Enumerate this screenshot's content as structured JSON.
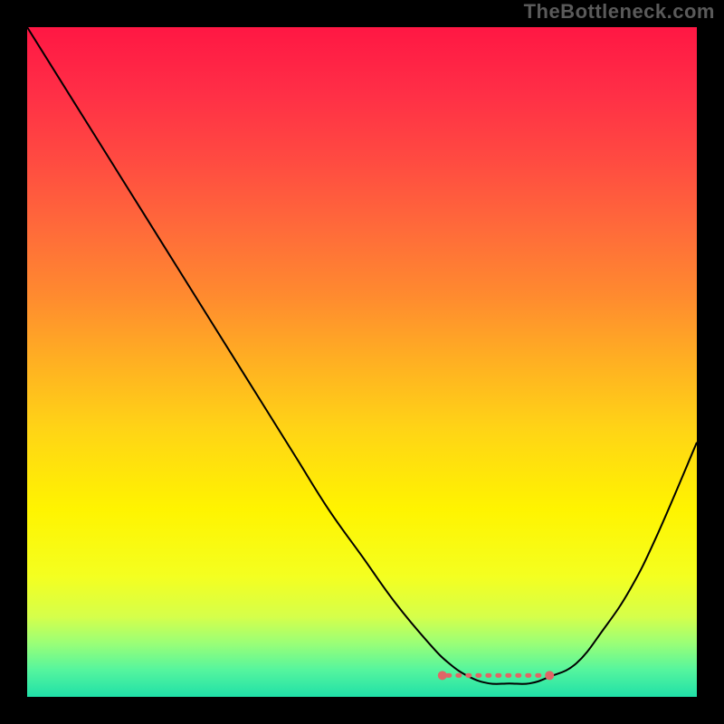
{
  "watermark": "TheBottleneck.com",
  "chart_data": {
    "type": "line",
    "title": "",
    "xlabel": "",
    "ylabel": "",
    "xlim": [
      0,
      100
    ],
    "ylim": [
      0,
      100
    ],
    "x": [
      0,
      5,
      10,
      15,
      20,
      25,
      30,
      35,
      40,
      45,
      50,
      55,
      60,
      63,
      66,
      69,
      72,
      75,
      78,
      82,
      86,
      90,
      94,
      100
    ],
    "values": [
      100,
      92,
      84,
      76,
      68,
      60,
      52,
      44,
      36,
      28,
      21,
      14,
      8,
      5,
      3,
      2,
      2,
      2,
      3,
      5,
      10,
      16,
      24,
      38
    ],
    "marker_range": {
      "x_start": 62,
      "x_end": 78,
      "y": 3.2
    },
    "gradient_stops": [
      {
        "offset": 0.0,
        "color": "#ff1744"
      },
      {
        "offset": 0.1,
        "color": "#ff2f46"
      },
      {
        "offset": 0.2,
        "color": "#ff4b41"
      },
      {
        "offset": 0.3,
        "color": "#ff6a3a"
      },
      {
        "offset": 0.4,
        "color": "#ff8a2f"
      },
      {
        "offset": 0.5,
        "color": "#ffb022"
      },
      {
        "offset": 0.6,
        "color": "#ffd416"
      },
      {
        "offset": 0.72,
        "color": "#fff400"
      },
      {
        "offset": 0.82,
        "color": "#f4ff20"
      },
      {
        "offset": 0.88,
        "color": "#d6ff4a"
      },
      {
        "offset": 0.92,
        "color": "#9aff77"
      },
      {
        "offset": 0.96,
        "color": "#55f59e"
      },
      {
        "offset": 1.0,
        "color": "#20e0a8"
      }
    ],
    "curve_color": "#000000",
    "marker_color": "#e06666"
  }
}
